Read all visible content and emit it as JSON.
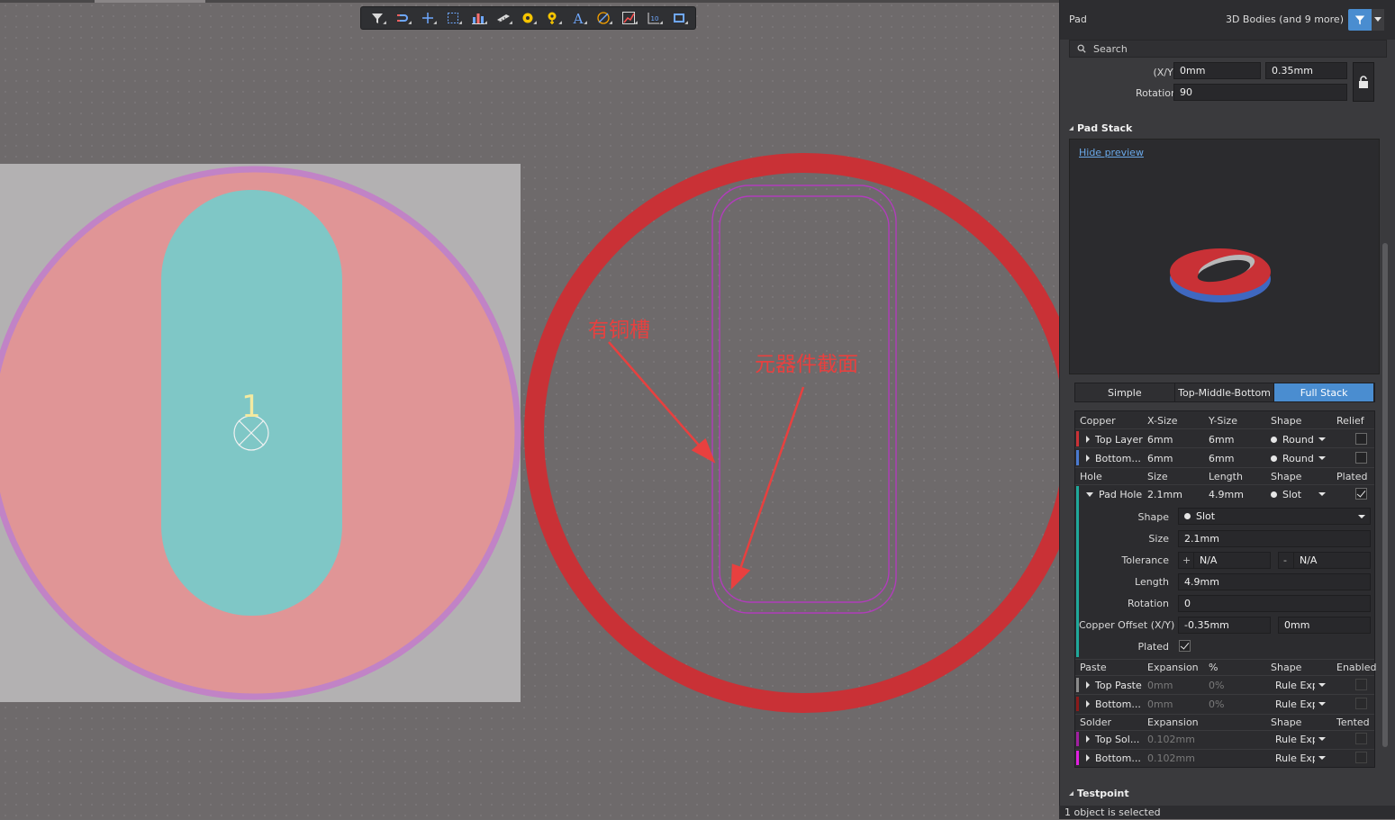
{
  "toolbar": {
    "icons": [
      "filter-icon",
      "snap-icon",
      "cross-icon",
      "select-rect-icon",
      "bar-chart-icon",
      "component-icon",
      "via-icon",
      "pad-icon",
      "text-icon",
      "arc-icon",
      "line-icon",
      "dimension-icon",
      "rect-icon"
    ]
  },
  "canvas": {
    "pad_designator": "1",
    "annotation_1": "有铜槽",
    "annotation_2": "元器件截面",
    "colors": {
      "board_gray": "#b3b1b2",
      "pad_pink": "#e09596",
      "slot_teal": "#7fc7c6",
      "outline_purple": "#c183c6",
      "ring_red": "#c93136",
      "annotation_red": "#e8403f"
    }
  },
  "panel": {
    "object_type": "Pad",
    "filter_label": "3D Bodies (and 9 more)",
    "search_placeholder": "Search",
    "xy_label": "(X/Y)",
    "x_value": "0mm",
    "y_value": "0.35mm",
    "rotation_label": "Rotation",
    "rotation_value": "90",
    "pad_stack_title": "Pad Stack",
    "hide_preview": "Hide preview",
    "modes": [
      "Simple",
      "Top-Middle-Bottom",
      "Full Stack"
    ],
    "active_mode": "Full Stack",
    "copper": {
      "headers": [
        "Copper",
        "X-Size",
        "Y-Size",
        "Shape",
        "Relief"
      ],
      "rows": [
        {
          "name": "Top Layer",
          "x": "6mm",
          "y": "6mm",
          "shape": "Round",
          "color": "#c93136"
        },
        {
          "name": "Bottom...",
          "x": "6mm",
          "y": "6mm",
          "shape": "Round",
          "color": "#4a7ad0"
        }
      ]
    },
    "hole": {
      "headers": [
        "Hole",
        "Size",
        "Length",
        "Shape",
        "Plated"
      ],
      "row": {
        "name": "Pad Hole",
        "size": "2.1mm",
        "length": "4.9mm",
        "shape": "Slot"
      },
      "shape_label": "Shape",
      "shape_value": "Slot",
      "size_label": "Size",
      "size_value": "2.1mm",
      "tolerance_label": "Tolerance",
      "tol_plus": "+",
      "tol_plus_value": "N/A",
      "tol_minus": "-",
      "tol_minus_value": "N/A",
      "length_label": "Length",
      "length_value": "4.9mm",
      "rotation_label": "Rotation",
      "rotation_value": "0",
      "offset_label": "Copper Offset (X/Y)",
      "offset_x": "-0.35mm",
      "offset_y": "0mm",
      "plated_label": "Plated"
    },
    "paste": {
      "headers": [
        "Paste",
        "Expansion",
        "%",
        "Shape",
        "Enabled"
      ],
      "rows": [
        {
          "name": "Top Paste",
          "exp": "0mm",
          "pct": "0%",
          "shape": "Rule Exp",
          "color": "#8a8a8a"
        },
        {
          "name": "Bottom...",
          "exp": "0mm",
          "pct": "0%",
          "shape": "Rule Exp",
          "color": "#8a1a1a"
        }
      ]
    },
    "solder": {
      "headers": [
        "Solder",
        "Expansion",
        "Shape",
        "Tented"
      ],
      "rows": [
        {
          "name": "Top Sol...",
          "exp": "0.102mm",
          "shape": "Rule Exp",
          "color": "#a020a0"
        },
        {
          "name": "Bottom...",
          "exp": "0.102mm",
          "shape": "Rule Exp",
          "color": "#e020e0"
        }
      ]
    },
    "testpoint_title": "Testpoint",
    "status": "1 object is selected"
  }
}
